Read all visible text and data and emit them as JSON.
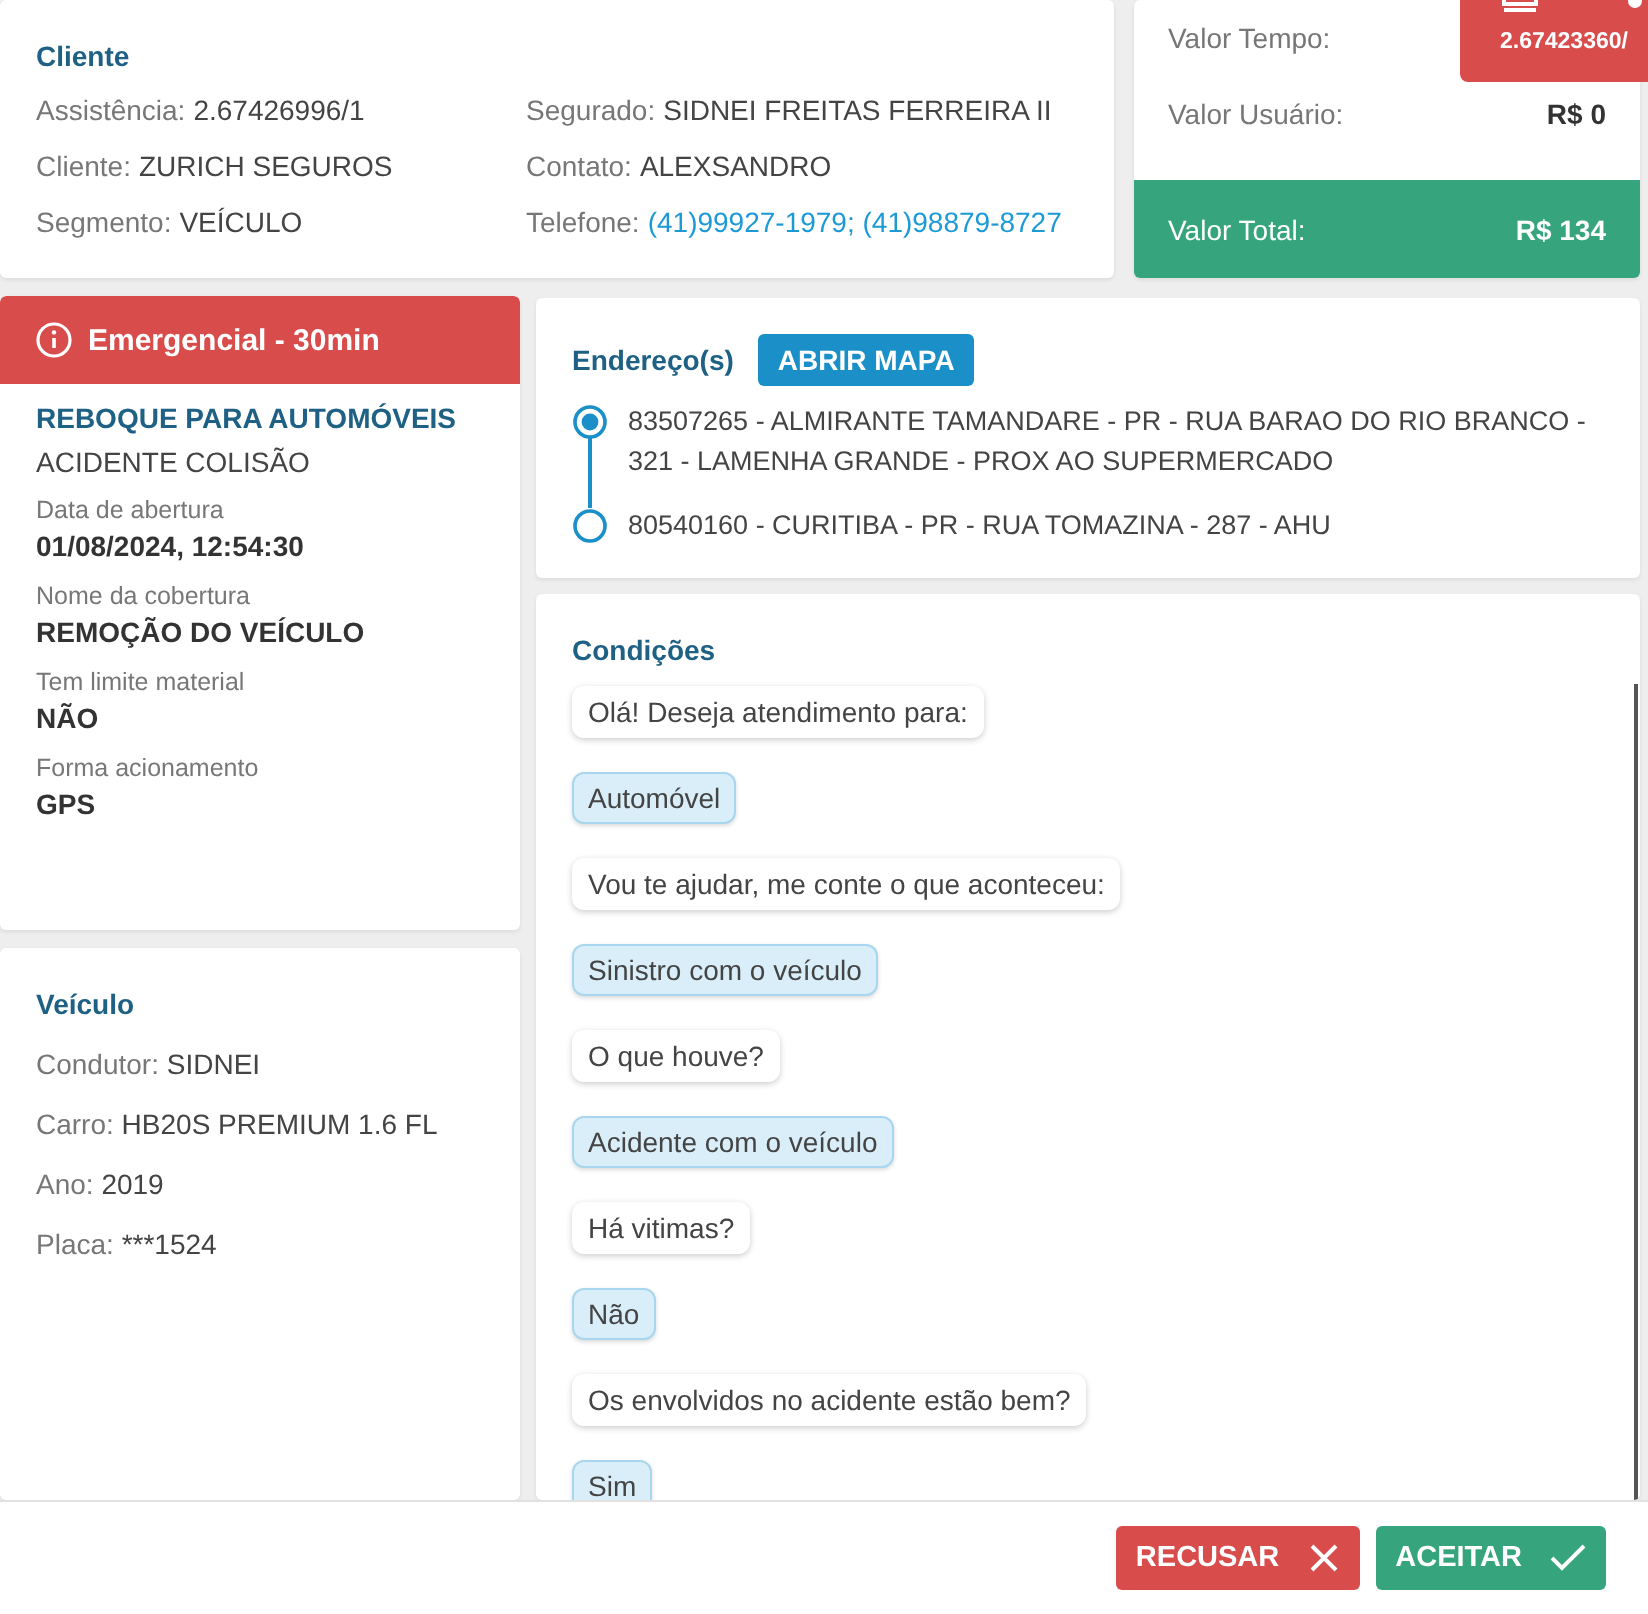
{
  "cliente": {
    "title": "Cliente",
    "columns": [
      [
        {
          "label": "Assistência:",
          "value": "2.67426996/1",
          "kind": "text"
        },
        {
          "label": "Cliente:",
          "value": "ZURICH SEGUROS",
          "kind": "text"
        },
        {
          "label": "Segmento:",
          "value": "VEÍCULO",
          "kind": "text"
        }
      ],
      [
        {
          "label": "Segurado:",
          "value": "SIDNEI FREITAS FERREIRA II",
          "kind": "text"
        },
        {
          "label": "Contato:",
          "value": "ALEXSANDRO",
          "kind": "text"
        },
        {
          "label": "Telefone:",
          "value": "(41)99927-1979; (41)98879-8727",
          "kind": "link"
        }
      ]
    ]
  },
  "valores": {
    "rows": [
      {
        "label": "Valor Tempo:"
      },
      {
        "label": "Valor Usuário:",
        "value": "R$ 0"
      }
    ],
    "total": {
      "label": "Valor Total:",
      "value": "R$ 134"
    }
  },
  "badge": {
    "text": "2.67423360/"
  },
  "servico": {
    "priority": "Emergencial - 30min",
    "title": "REBOQUE PARA AUTOMÓVEIS",
    "subtitle": "ACIDENTE COLISÃO",
    "fields": [
      {
        "label": "Data de abertura",
        "value": "01/08/2024, 12:54:30"
      },
      {
        "label": "Nome da cobertura",
        "value": "REMOÇÃO DO VEÍCULO"
      },
      {
        "label": "Tem limite material",
        "value": "NÃO"
      },
      {
        "label": "Forma acionamento",
        "value": "GPS"
      }
    ]
  },
  "veiculo": {
    "title": "Veículo",
    "rows": [
      {
        "label": "Condutor:",
        "value": "SIDNEI"
      },
      {
        "label": "Carro:",
        "value": "HB20S PREMIUM 1.6 FL"
      },
      {
        "label": "Ano:",
        "value": "2019"
      },
      {
        "label": "Placa:",
        "value": "***1524"
      }
    ]
  },
  "enderecos": {
    "title": "Endereço(s)",
    "button": "ABRIR MAPA",
    "items": [
      {
        "kind": "origin",
        "text": "83507265 - ALMIRANTE TAMANDARE - PR - RUA BARAO DO RIO BRANCO - 321 - LAMENHA GRANDE - PROX AO SUPERMERCADO"
      },
      {
        "kind": "destination",
        "text": "80540160 - CURITIBA - PR - RUA TOMAZINA - 287 - AHU"
      }
    ]
  },
  "condicoes": {
    "title": "Condições",
    "messages": [
      {
        "kind": "question",
        "text": "Olá! Deseja atendimento para:"
      },
      {
        "kind": "answer",
        "text": "Automóvel"
      },
      {
        "kind": "question",
        "text": "Vou te ajudar, me conte o que aconteceu:"
      },
      {
        "kind": "answer",
        "text": "Sinistro com o veículo"
      },
      {
        "kind": "question",
        "text": "O que houve?"
      },
      {
        "kind": "answer",
        "text": "Acidente com o veículo"
      },
      {
        "kind": "question",
        "text": "Há vitimas?"
      },
      {
        "kind": "answer",
        "text": "Não"
      },
      {
        "kind": "question",
        "text": "Os envolvidos no acidente estão bem?"
      },
      {
        "kind": "answer",
        "text": "Sim"
      }
    ]
  },
  "footer": {
    "buttons": [
      {
        "kind": "reject",
        "label": "RECUSAR"
      },
      {
        "kind": "accept",
        "label": "ACEITAR"
      }
    ]
  }
}
